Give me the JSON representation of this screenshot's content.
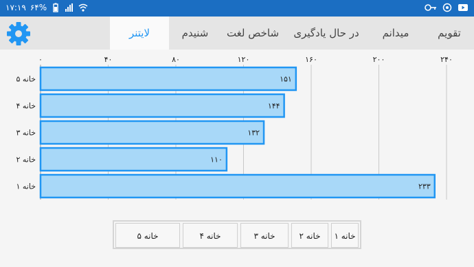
{
  "status": {
    "time": "۱۷:۱۹",
    "battery": "۶۴%"
  },
  "tabs": [
    {
      "label": "تقویم"
    },
    {
      "label": "میدانم"
    },
    {
      "label": "در حال یادگیری"
    },
    {
      "label": "شاخص لغت"
    },
    {
      "label": "شنیدم"
    },
    {
      "label": "لایتنر"
    }
  ],
  "chart_data": {
    "type": "bar",
    "orientation": "horizontal",
    "categories": [
      "خانه ۵",
      "خانه ۴",
      "خانه ۳",
      "خانه ۲",
      "خانه ۱"
    ],
    "values": [
      151,
      144,
      132,
      110,
      233
    ],
    "value_labels": [
      "۱۵۱",
      "۱۴۴",
      "۱۳۲",
      "۱۱۰",
      "۲۳۳"
    ],
    "x_ticks": [
      0,
      40,
      80,
      120,
      160,
      200,
      240
    ],
    "x_tick_labels": [
      "۰",
      "۴۰",
      "۸۰",
      "۱۲۰",
      "۱۶۰",
      "۲۰۰",
      "۲۴۰"
    ],
    "xlim": [
      0,
      240
    ],
    "grid": true,
    "bar_fill": "#a8d8f8",
    "bar_stroke": "#2196f3"
  },
  "legend": {
    "items": [
      "خانه ۵",
      "خانه ۴",
      "خانه ۳",
      "خانه ۲",
      "خانه ۱"
    ]
  },
  "colors": {
    "statusbar": "#1b6ec2",
    "accent": "#2196f3"
  }
}
